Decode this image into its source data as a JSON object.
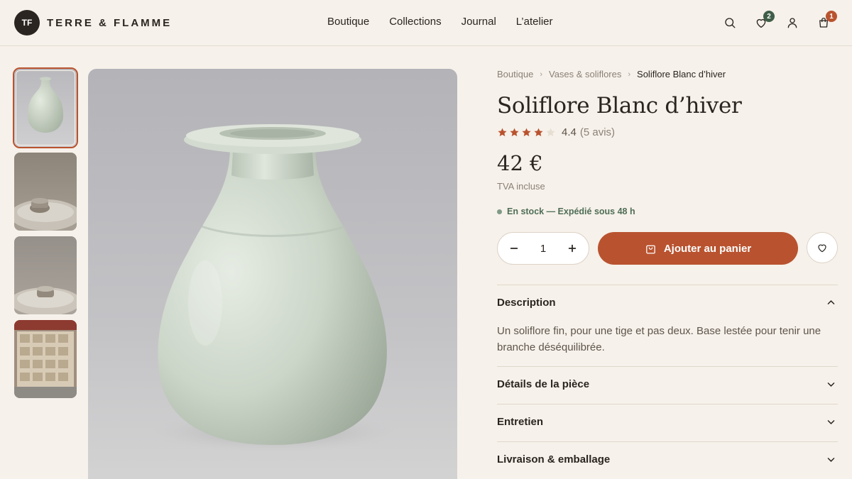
{
  "brand": {
    "mark": "TF",
    "name": "TERRE & FLAMME"
  },
  "nav": [
    "Boutique",
    "Collections",
    "Journal",
    "L’atelier"
  ],
  "header_icons": {
    "wishlist_count": "2",
    "cart_count": "1",
    "wishlist_badge_color": "#3f5e48",
    "cart_badge_color": "#b9532f"
  },
  "breadcrumb": [
    "Boutique",
    "Vases & soliflores",
    "Soliflore Blanc d’hiver"
  ],
  "product": {
    "title": "Soliflore Blanc d’hiver",
    "rating_value": "4.4",
    "rating_stars": 4,
    "rating_max": 5,
    "review_count": "(5 avis)",
    "price": "42 €",
    "tax_note": "TVA incluse",
    "stock": "En stock — Expédié sous 48 h",
    "quantity": "1",
    "add_to_cart": "Ajouter au panier"
  },
  "accordion": [
    {
      "title": "Description",
      "open": true,
      "body": "Un soliflore fin, pour une tige et pas deux. Base lestée pour tenir une branche déséquilibrée."
    },
    {
      "title": "Détails de la pièce",
      "open": false
    },
    {
      "title": "Entretien",
      "open": false
    },
    {
      "title": "Livraison & emballage",
      "open": false
    }
  ],
  "colors": {
    "accent": "#b9532f",
    "background": "#f6f1ea",
    "stock_green": "#4f6e57",
    "glaze": "#cdd6c9"
  },
  "gallery": {
    "thumbnails": [
      "vase-front",
      "vase-on-wheel",
      "vase-on-wheel-small",
      "studio-shelves"
    ],
    "active_index": 0
  }
}
